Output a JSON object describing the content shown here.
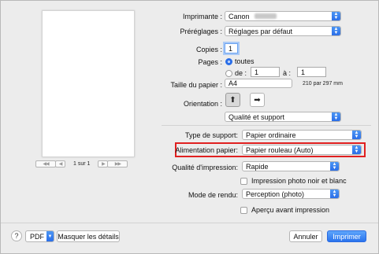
{
  "printer": {
    "label": "Imprimante :",
    "value": "Canon"
  },
  "presets": {
    "label": "Préréglages :",
    "value": "Réglages par défaut"
  },
  "copies": {
    "label": "Copies :",
    "value": "1"
  },
  "pages": {
    "label": "Pages :",
    "all_label": "toutes",
    "from_label": "de :",
    "from_value": "1",
    "to_label": "à :",
    "to_value": "1"
  },
  "paper_size": {
    "label": "Taille du papier :",
    "value": "A4",
    "dimensions": "210 par 297 mm"
  },
  "orientation": {
    "label": "Orientation :"
  },
  "section": {
    "value": "Qualité et support"
  },
  "media_type": {
    "label": "Type de support:",
    "value": "Papier ordinaire"
  },
  "paper_source": {
    "label": "Alimentation papier:",
    "value": "Papier rouleau (Auto)"
  },
  "print_quality": {
    "label": "Qualité d'impression:",
    "value": "Rapide"
  },
  "grayscale": {
    "label": "Impression photo noir et blanc"
  },
  "rendering": {
    "label": "Mode de rendu:",
    "value": "Perception (photo)"
  },
  "preview_check": {
    "label": "Aperçu avant impression"
  },
  "pager": {
    "text": "1 sur 1",
    "first": "◀◀",
    "prev": "◀",
    "next": "▶",
    "last": "▶▶"
  },
  "footer": {
    "help": "?",
    "pdf": "PDF",
    "details": "Masquer les détails",
    "cancel": "Annuler",
    "print": "Imprimer"
  },
  "colors": {
    "accent": "#2a6ee8",
    "highlight": "#e02020"
  }
}
